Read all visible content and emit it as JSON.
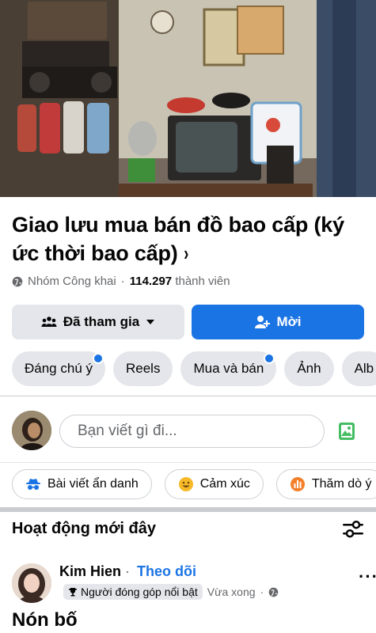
{
  "group": {
    "title": "Giao lưu mua bán đồ bao cấp (ký ức thời bao cấp)",
    "title_chevron": "›",
    "privacy": "Nhóm Công khai",
    "separator": "·",
    "member_count": "114.297",
    "member_label": "thành viên"
  },
  "buttons": {
    "joined": "Đã tham gia",
    "invite": "Mời"
  },
  "chips": [
    {
      "label": "Đáng chú ý",
      "dot": true
    },
    {
      "label": "Reels",
      "dot": false
    },
    {
      "label": "Mua và bán",
      "dot": true
    },
    {
      "label": "Ảnh",
      "dot": false
    },
    {
      "label": "Alb",
      "dot": false
    }
  ],
  "composer": {
    "placeholder": "Bạn viết gì đi..."
  },
  "actions": {
    "anonymous": "Bài viết ẩn danh",
    "feeling": "Cảm xúc",
    "poll": "Thăm dò ý"
  },
  "recent": {
    "title": "Hoạt động mới đây"
  },
  "post": {
    "author": "Kim Hien",
    "separator": "·",
    "follow": "Theo dõi",
    "badge": "Người đóng góp nổi bật",
    "time": "Vừa xong",
    "time_separator": "·",
    "title": "Nón bố",
    "more": "···"
  },
  "colors": {
    "accent": "#1b74e4",
    "chip_bg": "#e4e6eb",
    "muted_text": "#65676b"
  }
}
